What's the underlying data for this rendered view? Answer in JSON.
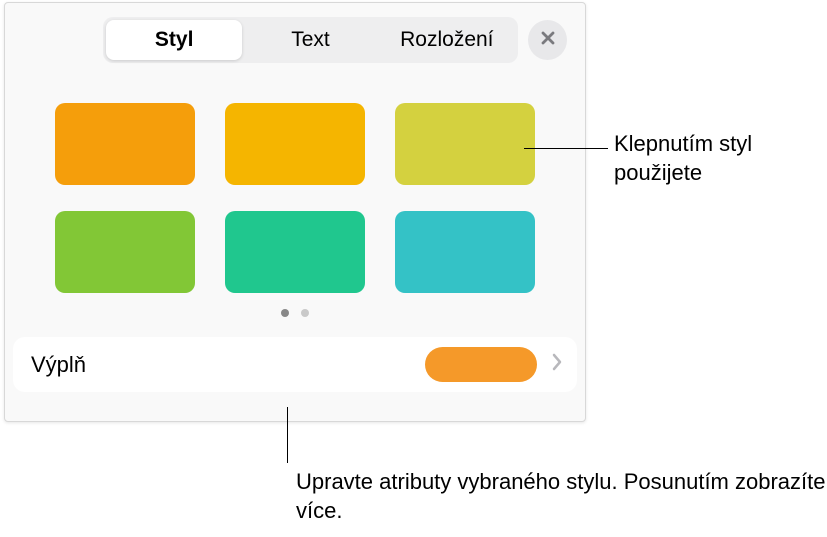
{
  "tabs": {
    "style": "Styl",
    "text": "Text",
    "layout": "Rozložení"
  },
  "swatches": [
    {
      "color": "#F59E0B",
      "name": "orange"
    },
    {
      "color": "#F5B500",
      "name": "amber"
    },
    {
      "color": "#D4D13F",
      "name": "olive"
    },
    {
      "color": "#82C736",
      "name": "green"
    },
    {
      "color": "#20C78E",
      "name": "teal"
    },
    {
      "color": "#34C2C6",
      "name": "cyan"
    }
  ],
  "pager": {
    "active": 0
  },
  "fill": {
    "label": "Výplň",
    "color": "#F59929"
  },
  "callouts": {
    "apply": "Klepnutím styl použijete",
    "edit": "Upravte atributy vybraného stylu. Posunutím zobrazíte více."
  }
}
